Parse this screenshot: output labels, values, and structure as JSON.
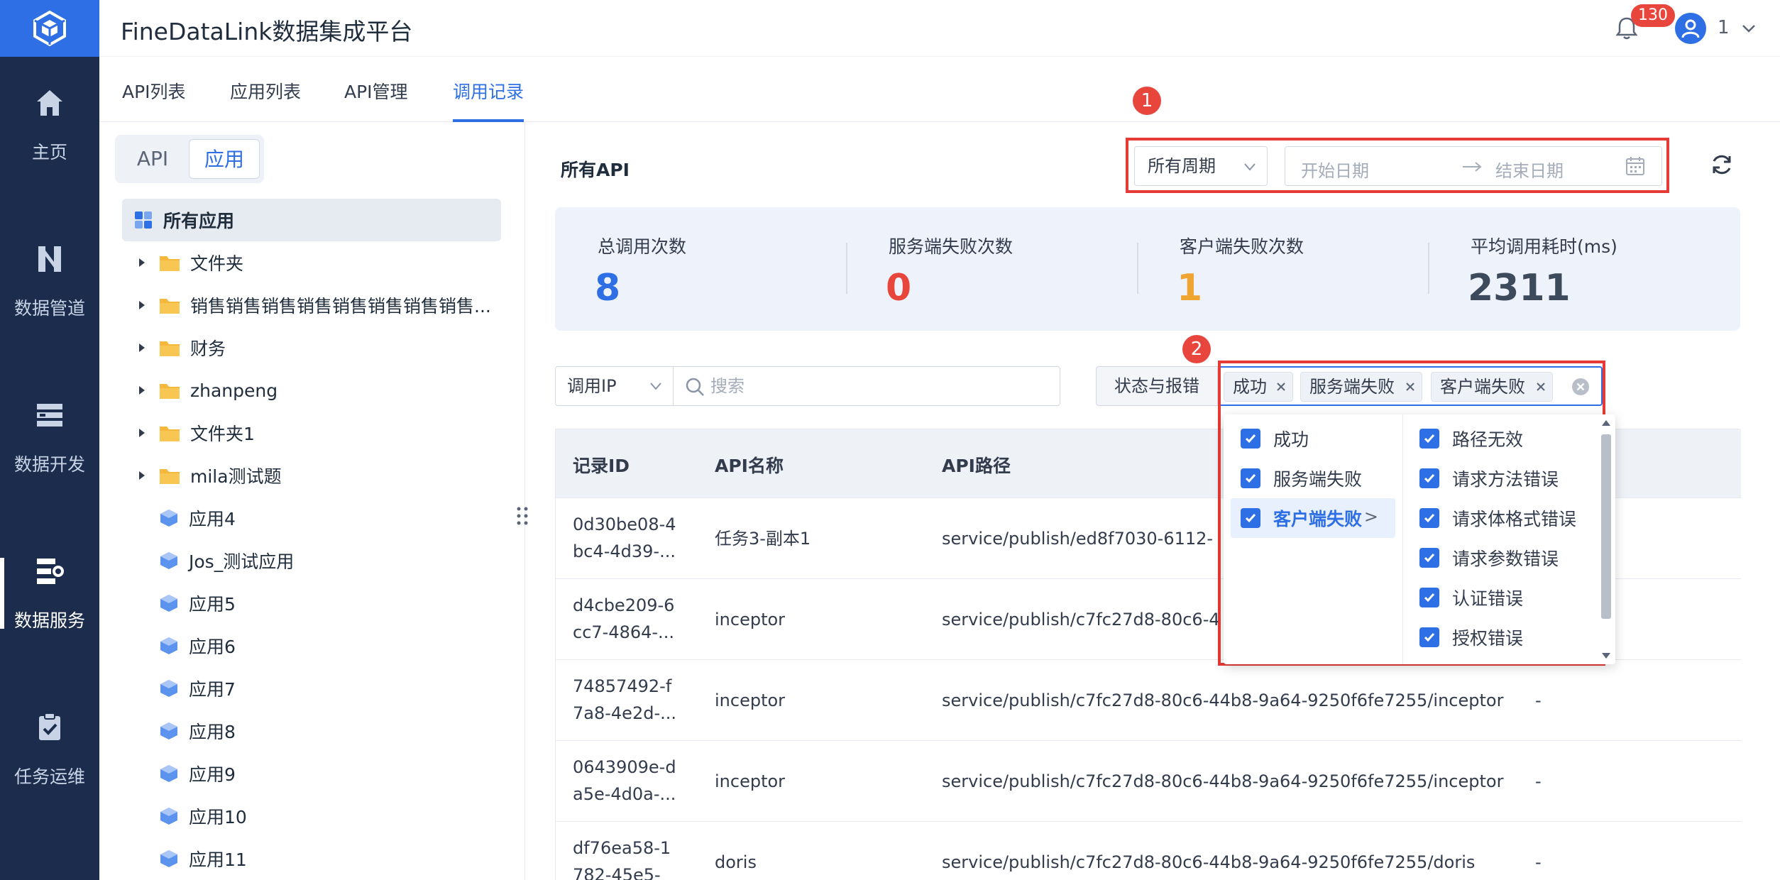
{
  "app": {
    "title": "FineDataLink数据集成平台",
    "notification_count": "130",
    "user_name": "1"
  },
  "nav": {
    "items": [
      {
        "label": "主页",
        "icon": "home-icon"
      },
      {
        "label": "数据管道",
        "icon": "pipeline-icon"
      },
      {
        "label": "数据开发",
        "icon": "dev-icon"
      },
      {
        "label": "数据服务",
        "icon": "service-icon",
        "active": true
      },
      {
        "label": "任务运维",
        "icon": "ops-icon"
      }
    ]
  },
  "tabs": [
    {
      "label": "API列表"
    },
    {
      "label": "应用列表"
    },
    {
      "label": "API管理"
    },
    {
      "label": "调用记录",
      "active": true
    }
  ],
  "tree": {
    "segments": [
      "API",
      "应用"
    ],
    "active_segment": "应用",
    "root": "所有应用",
    "folders": [
      "文件夹",
      "销售销售销售销售销售销售销售销售...",
      "财务",
      "zhanpeng",
      "文件夹1",
      "mila测试题"
    ],
    "apps": [
      "应用4",
      "Jos_测试应用",
      "应用5",
      "应用6",
      "应用7",
      "应用8",
      "应用9",
      "应用10",
      "应用11"
    ]
  },
  "main": {
    "title": "所有API",
    "period": "所有周期",
    "start_placeholder": "开始日期",
    "end_placeholder": "结束日期",
    "markers": [
      "1",
      "2"
    ]
  },
  "stats": [
    {
      "label": "总调用次数",
      "value": "8",
      "color": "#2e6fe6"
    },
    {
      "label": "服务端失败次数",
      "value": "0",
      "color": "#e8453c"
    },
    {
      "label": "客户端失败次数",
      "value": "1",
      "color": "#f0a532"
    },
    {
      "label": "平均调用耗时(ms)",
      "value": "2311",
      "color": "#3d4a5c"
    }
  ],
  "filters": {
    "ip_select": "调用IP",
    "search_placeholder": "搜索",
    "status_label": "状态与报错",
    "chips": [
      "成功",
      "服务端失败",
      "客户端失败"
    ]
  },
  "table": {
    "headers": [
      "记录ID",
      "API名称",
      "API路径"
    ],
    "rows": [
      {
        "id_line1": "0d30be08-4",
        "id_line2": "bc4-4d39-...",
        "name": "任务3-副本1",
        "path": "service/publish/ed8f7030-6112-",
        "extra": ""
      },
      {
        "id_line1": "d4cbe209-6",
        "id_line2": "cc7-4864-...",
        "name": "inceptor",
        "path": "service/publish/c7fc27d8-80c6-4",
        "extra": ""
      },
      {
        "id_line1": "74857492-f",
        "id_line2": "7a8-4e2d-...",
        "name": "inceptor",
        "path": "service/publish/c7fc27d8-80c6-44b8-9a64-9250f6fe7255/inceptor",
        "extra": "-"
      },
      {
        "id_line1": "0643909e-d",
        "id_line2": "a5e-4d0a-...",
        "name": "inceptor",
        "path": "service/publish/c7fc27d8-80c6-44b8-9a64-9250f6fe7255/inceptor",
        "extra": "-"
      },
      {
        "id_line1": "df76ea58-1",
        "id_line2": "782-45e5-",
        "name": "doris",
        "path": "service/publish/c7fc27d8-80c6-44b8-9a64-9250f6fe7255/doris",
        "extra": "-"
      }
    ]
  },
  "dropdown": {
    "left_options": [
      "成功",
      "服务端失败",
      "客户端失败"
    ],
    "highlighted": "客户端失败",
    "more_glyph": ">",
    "right_options": [
      "路径无效",
      "请求方法错误",
      "请求体格式错误",
      "请求参数错误",
      "认证错误",
      "授权错误"
    ]
  },
  "colors": {
    "accent": "#2e6fe6",
    "rail": "#1c2c4d",
    "annotation_red": "#e63a36"
  }
}
